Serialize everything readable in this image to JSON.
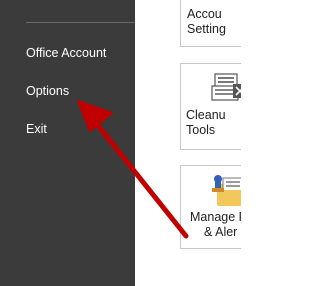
{
  "sidebar": {
    "items": [
      {
        "label": "Office Account"
      },
      {
        "label": "Options"
      },
      {
        "label": "Exit"
      }
    ]
  },
  "tiles": {
    "account": {
      "line1": "Accou",
      "line2": "Setting"
    },
    "cleanup": {
      "line1": "Cleanu",
      "line2": "Tools"
    },
    "rules": {
      "line1": "Manage R",
      "line2": "& Aler"
    }
  },
  "icons": {
    "cleanup": "cleanup-tools-icon",
    "rules": "manage-rules-icon",
    "arrow": "red-arrow-annotation"
  },
  "colors": {
    "sidebar_bg": "#3b3b3b",
    "arrow": "#c00000"
  }
}
